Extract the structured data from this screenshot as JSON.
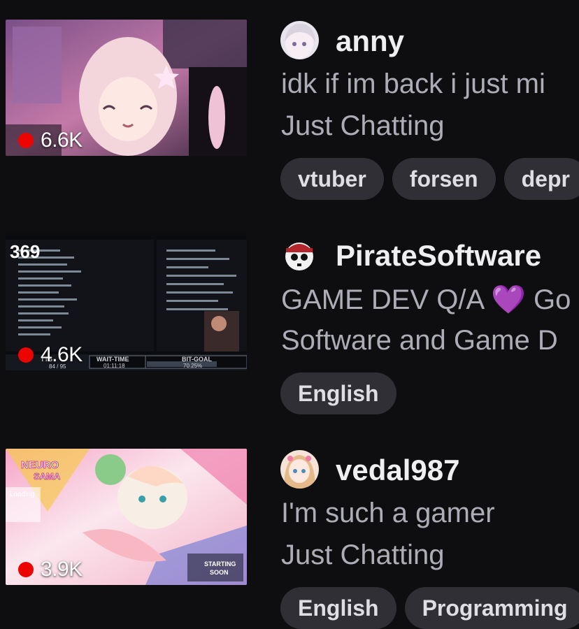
{
  "streams": [
    {
      "channel": "anny",
      "title": "idk if im back i just mi",
      "category": "Just Chatting",
      "viewers": "6.6K",
      "tags": [
        "vtuber",
        "forsen",
        "depr"
      ]
    },
    {
      "channel": "PirateSoftware",
      "title_prefix": "GAME DEV Q/A",
      "title_emoji": "💜",
      "title_suffix": "Go",
      "category": "Software and Game D",
      "viewers": "4.6K",
      "tags": [
        "English"
      ],
      "thumb_overlay": {
        "badge": "369",
        "labels": [
          "TTS",
          "WAIT-TIME",
          "BIT-GOAL"
        ],
        "values": [
          "84 / 95",
          "01:11:18",
          "70.25%"
        ]
      }
    },
    {
      "channel": "vedal987",
      "title": "I'm such a gamer",
      "category": "Just Chatting",
      "viewers": "3.9K",
      "tags": [
        "English",
        "Programming"
      ],
      "thumb_overlay": {
        "logo_top": "NEURO",
        "logo_bottom": "SAMA",
        "loading": "Loading",
        "starting_1": "STARTING",
        "starting_2": "SOON"
      }
    }
  ],
  "colors": {
    "background": "#0e0e10",
    "live": "#eb0400",
    "tag_bg": "#2f2f35",
    "muted_text": "#adadb8"
  }
}
